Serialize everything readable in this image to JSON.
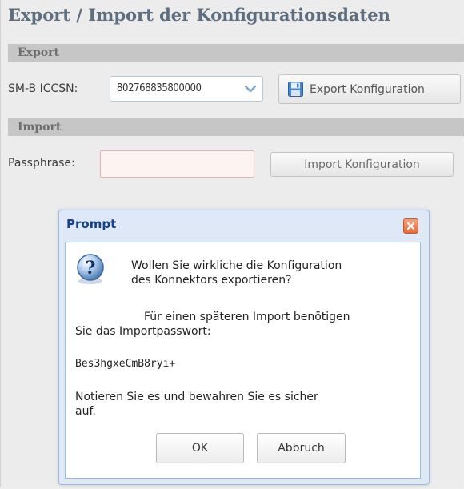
{
  "title": "Export / Import der Konfigurationsdaten",
  "export_section": {
    "header": "Export",
    "iccsn_label": "SM-B ICCSN:",
    "iccsn_value": "802768835800000",
    "export_button": "Export Konfiguration"
  },
  "import_section": {
    "header": "Import",
    "passphrase_label": "Passphrase:",
    "passphrase_value": "",
    "import_button": "Import Konfiguration"
  },
  "dialog": {
    "title": "Prompt",
    "line1": "Wollen Sie wirkliche die Konfiguration",
    "line2": "des Konnektors exportieren?",
    "line3": "Für einen späteren Import benötigen",
    "line4": "Sie das Importpasswort:",
    "password": "Bes3hgxeCmB8ryi+",
    "line5": "Notieren Sie es und bewahren Sie es sicher",
    "line6": "auf.",
    "ok_button": "OK",
    "cancel_button": "Abbruch"
  },
  "icons": [
    "floppy-disk-icon",
    "chevron-down-icon",
    "close-icon",
    "question-icon"
  ],
  "colors": {
    "title": "#5d6e7f",
    "section_header_bg": "#c6c6c6",
    "dialog_title": "#15428b",
    "dialog_frame": "#dfe8f6",
    "close_button": "#e86b3a",
    "invalid_field_border": "#e4b0b0"
  }
}
